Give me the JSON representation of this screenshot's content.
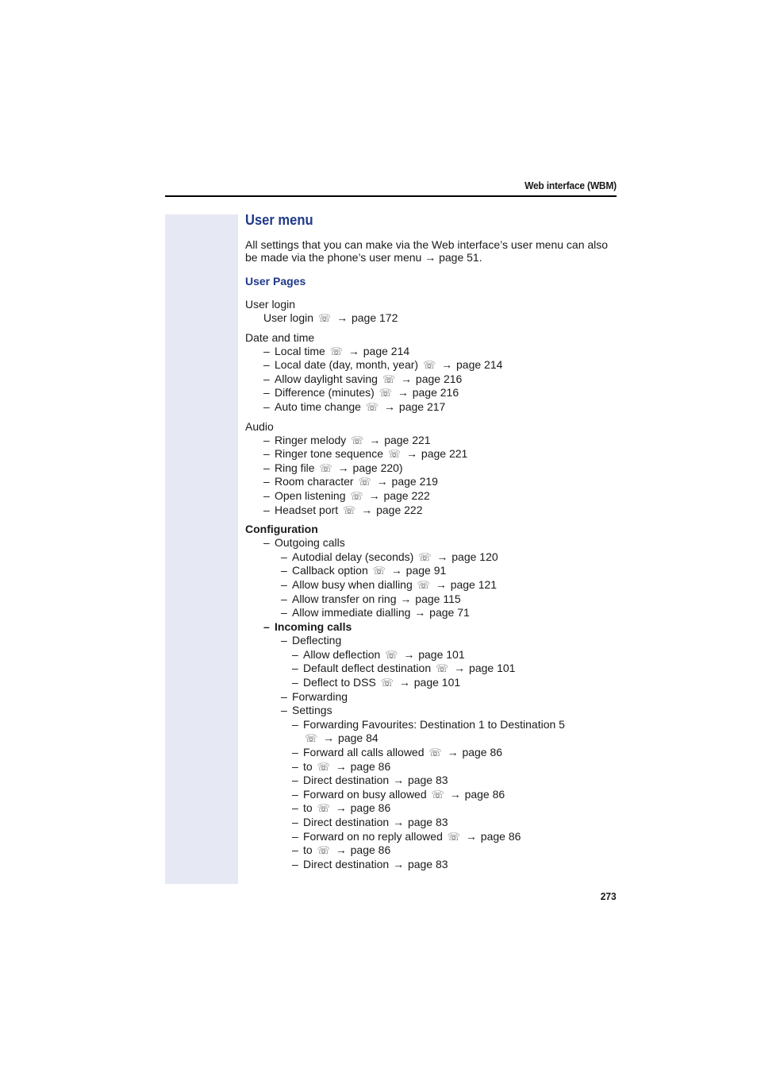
{
  "header": {
    "title": "Web interface (WBM)"
  },
  "section": {
    "title": "User menu",
    "intro": "All settings that you can make via the Web interface’s user menu can also be made via the phone’s user menu → page 51.",
    "subtitle": "User Pages"
  },
  "groups": [
    {
      "label": "User login",
      "bold": false,
      "items": [
        {
          "level": 1,
          "dash": false,
          "text": "User login",
          "phone": true,
          "ref": "page 172"
        }
      ]
    },
    {
      "label": "Date and time",
      "bold": false,
      "items": [
        {
          "level": 1,
          "dash": true,
          "text": "Local time",
          "phone": true,
          "ref": "page 214"
        },
        {
          "level": 1,
          "dash": true,
          "text": "Local date (day, month, year)",
          "phone": true,
          "ref": "page 214"
        },
        {
          "level": 1,
          "dash": true,
          "text": "Allow daylight saving",
          "phone": true,
          "ref": "page 216"
        },
        {
          "level": 1,
          "dash": true,
          "text": "Difference (minutes)",
          "phone": true,
          "ref": "page 216"
        },
        {
          "level": 1,
          "dash": true,
          "text": "Auto time change",
          "phone": true,
          "ref": "page 217"
        }
      ]
    },
    {
      "label": "Audio",
      "bold": false,
      "items": [
        {
          "level": 1,
          "dash": true,
          "text": "Ringer melody",
          "phone": true,
          "ref": "page 221"
        },
        {
          "level": 1,
          "dash": true,
          "text": "Ringer tone sequence",
          "phone": true,
          "ref": "page 221"
        },
        {
          "level": 1,
          "dash": true,
          "text": "Ring file",
          "phone": true,
          "ref": "page 220)"
        },
        {
          "level": 1,
          "dash": true,
          "text": "Room character",
          "phone": true,
          "ref": "page 219"
        },
        {
          "level": 1,
          "dash": true,
          "text": "Open listening",
          "phone": true,
          "ref": "page 222"
        },
        {
          "level": 1,
          "dash": true,
          "text": "Headset port",
          "phone": true,
          "ref": "page 222"
        }
      ]
    },
    {
      "label": "Configuration",
      "bold": true,
      "items": [
        {
          "level": 1,
          "dash": true,
          "text": "Outgoing calls",
          "phone": false,
          "ref": ""
        },
        {
          "level": 2,
          "dash": true,
          "text": "Autodial delay (seconds)",
          "phone": true,
          "ref": "page 120"
        },
        {
          "level": 2,
          "dash": true,
          "text": "Callback option",
          "phone": true,
          "ref": "page 91"
        },
        {
          "level": 2,
          "dash": true,
          "text": "Allow busy when dialling",
          "phone": true,
          "ref": "page 121"
        },
        {
          "level": 2,
          "dash": true,
          "text": "Allow transfer on ring",
          "phone": false,
          "ref": "page 115"
        },
        {
          "level": 2,
          "dash": true,
          "text": "Allow immediate dialling",
          "phone": false,
          "ref": "page 71"
        },
        {
          "level": 1,
          "dash": true,
          "text": "Incoming calls",
          "phone": false,
          "ref": "",
          "bold": true
        },
        {
          "level": 2,
          "dash": true,
          "text": "Deflecting",
          "phone": false,
          "ref": ""
        },
        {
          "level": 3,
          "dash": true,
          "text": "Allow deflection",
          "phone": true,
          "ref": "page 101"
        },
        {
          "level": 3,
          "dash": true,
          "text": "Default deflect destination",
          "phone": true,
          "ref": "page 101"
        },
        {
          "level": 3,
          "dash": true,
          "text": "Deflect to DSS",
          "phone": true,
          "ref": "page 101"
        },
        {
          "level": 2,
          "dash": true,
          "text": "Forwarding",
          "phone": false,
          "ref": ""
        },
        {
          "level": 2,
          "dash": true,
          "text": "Settings",
          "phone": false,
          "ref": ""
        },
        {
          "level": 3,
          "dash": true,
          "text": "Forwarding Favourites: Destination 1 to Destination 5",
          "phone": false,
          "ref": ""
        },
        {
          "level": 3,
          "dash": false,
          "text": "",
          "phone": true,
          "ref": "page 84"
        },
        {
          "level": 3,
          "dash": true,
          "text": "Forward all calls allowed",
          "phone": true,
          "ref": "page 86"
        },
        {
          "level": 3,
          "dash": true,
          "text": "to",
          "phone": true,
          "ref": "page 86"
        },
        {
          "level": 3,
          "dash": true,
          "text": "Direct destination",
          "phone": false,
          "ref": "page 83"
        },
        {
          "level": 3,
          "dash": true,
          "text": "Forward on busy allowed",
          "phone": true,
          "ref": "page 86"
        },
        {
          "level": 3,
          "dash": true,
          "text": "to",
          "phone": true,
          "ref": "page 86"
        },
        {
          "level": 3,
          "dash": true,
          "text": "Direct destination",
          "phone": false,
          "ref": "page 83"
        },
        {
          "level": 3,
          "dash": true,
          "text": "Forward on no reply allowed",
          "phone": true,
          "ref": "page 86"
        },
        {
          "level": 3,
          "dash": true,
          "text": "to",
          "phone": true,
          "ref": "page 86"
        },
        {
          "level": 3,
          "dash": true,
          "text": "Direct destination",
          "phone": false,
          "ref": "page 83"
        }
      ]
    }
  ],
  "symbols": {
    "dash": "–",
    "phone": "☏",
    "arrow": "→"
  },
  "footer": {
    "page_number": "273"
  }
}
